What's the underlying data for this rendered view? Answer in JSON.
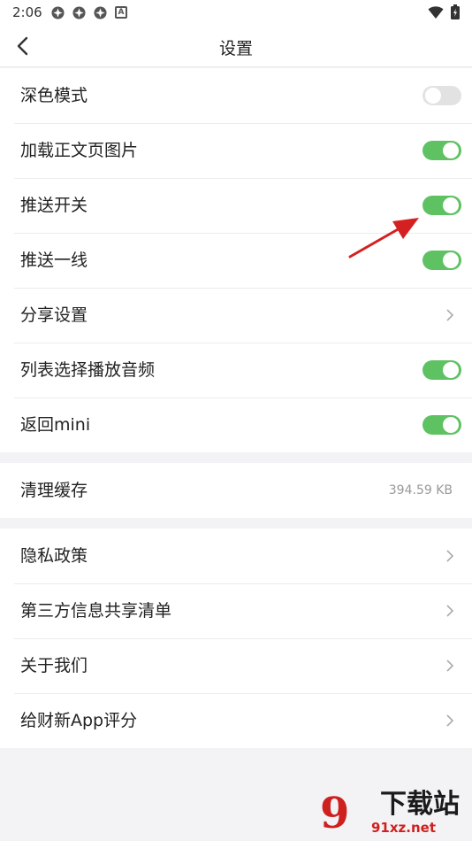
{
  "status_bar": {
    "time": "2:06",
    "notification_icons": [
      "app-icon",
      "app-icon",
      "app-icon",
      "a-box-icon"
    ],
    "right_icons": [
      "wifi-icon",
      "battery-icon"
    ]
  },
  "header": {
    "title": "设置",
    "back_icon": "chevron-left-icon"
  },
  "settings": {
    "group1": [
      {
        "label": "深色模式",
        "control": "toggle",
        "on": false
      },
      {
        "label": "加载正文页图片",
        "control": "toggle",
        "on": true
      },
      {
        "label": "推送开关",
        "control": "toggle",
        "on": true
      },
      {
        "label": "推送一线",
        "control": "toggle",
        "on": true
      },
      {
        "label": "分享设置",
        "control": "chevron"
      },
      {
        "label": "列表选择播放音频",
        "control": "toggle",
        "on": true
      },
      {
        "label": "返回mini",
        "control": "toggle",
        "on": true
      }
    ],
    "cache": {
      "label": "清理缓存",
      "value": "394.59 KB"
    },
    "group3": [
      {
        "label": "隐私政策",
        "control": "chevron"
      },
      {
        "label": "第三方信息共享清单",
        "control": "chevron"
      },
      {
        "label": "关于我们",
        "control": "chevron"
      },
      {
        "label": "给财新App评分",
        "control": "chevron"
      }
    ]
  },
  "colors": {
    "toggle_on": "#5ec262",
    "toggle_off": "#e2e2e2",
    "annotation_arrow": "#d42020"
  },
  "watermark": {
    "number": "9",
    "title": "下载站",
    "url": "91xz.net"
  }
}
